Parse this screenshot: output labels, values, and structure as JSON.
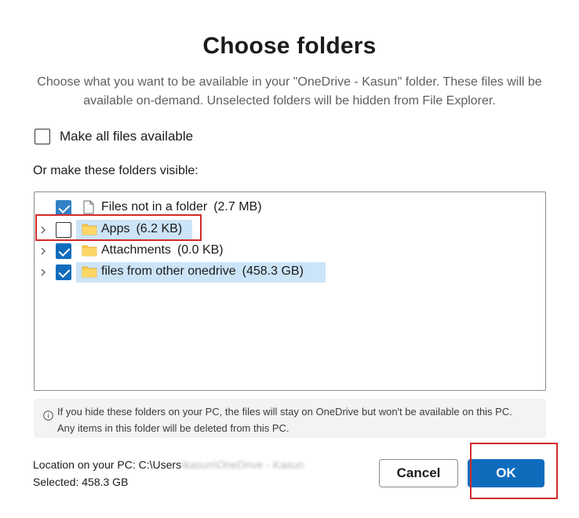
{
  "dialog": {
    "title": "Choose folders",
    "subtitle": "Choose what you want to be available in your \"OneDrive - Kasun\" folder. These files will be available on-demand. Unselected folders will be hidden from File Explorer."
  },
  "make_all": {
    "label": "Make all files available",
    "checked": false
  },
  "folders_label": "Or make these folders visible:",
  "tree": [
    {
      "name": "Files not in a folder",
      "size": "(2.7 MB)",
      "type": "file",
      "checked": true,
      "expandable": false,
      "highlighted": false
    },
    {
      "name": "Apps",
      "size": "(6.2 KB)",
      "type": "folder",
      "checked": false,
      "expandable": true,
      "highlighted": true
    },
    {
      "name": "Attachments",
      "size": "(0.0 KB)",
      "type": "folder",
      "checked": true,
      "expandable": true,
      "highlighted": false
    },
    {
      "name": "files from other onedrive",
      "size": "(458.3 GB)",
      "type": "folder",
      "checked": true,
      "expandable": true,
      "highlighted": true
    }
  ],
  "info": {
    "icon": "info-icon",
    "line1": "If you hide these folders on your PC, the files will stay on OneDrive but won't be available on this PC.",
    "line2": "Any items in this folder will be deleted from this PC."
  },
  "location": {
    "label": "Location on your PC: C:\\Users",
    "redacted_text": "\\kasun\\OneDrive - Kasun",
    "selected": "Selected: 458.3 GB"
  },
  "buttons": {
    "cancel": "Cancel",
    "ok": "OK"
  },
  "colors": {
    "accent": "#0f6cbd",
    "highlight": "#cce4f7",
    "annotation_red": "#d32a2a",
    "folder": "#f8c84a"
  }
}
